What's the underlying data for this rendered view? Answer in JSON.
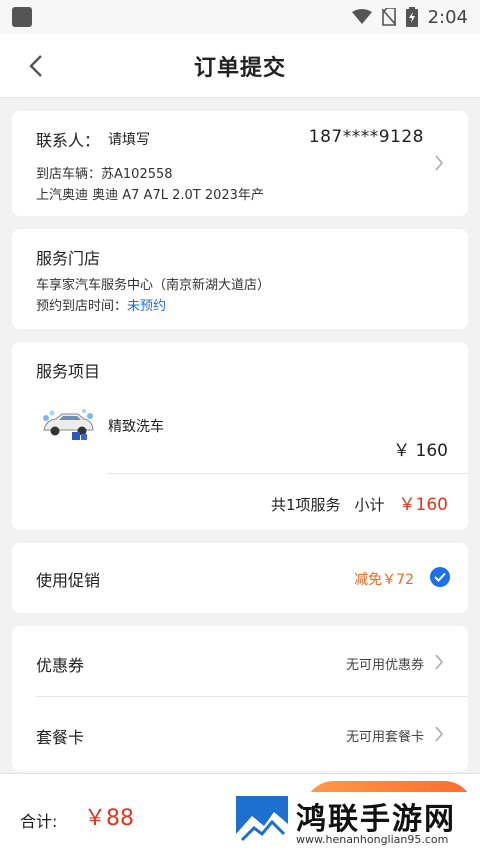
{
  "status_bar": {
    "time": "2:04"
  },
  "header": {
    "title": "订单提交"
  },
  "contact": {
    "label": "联系人：",
    "value": "请填写",
    "phone": "187****9128",
    "vehicle_label": "到店车辆：",
    "plate": "苏A102558",
    "model": "上汽奥迪 奥迪 A7 A7L 2.0T 2023年产"
  },
  "store": {
    "title": "服务门店",
    "name": "车享家汽车服务中心（南京新湖大道店）",
    "appointment_label": "预约到店时间：",
    "appointment_value": "未预约"
  },
  "service": {
    "title": "服务项目",
    "item_name": "精致洗车",
    "item_price": "￥ 160",
    "count_text": "共1项服务",
    "subtotal_label": "小计",
    "subtotal_value": "￥160"
  },
  "promo": {
    "label": "使用促销",
    "discount": "减免￥72",
    "checked": true
  },
  "coupon": {
    "label": "优惠券",
    "value": "无可用优惠券"
  },
  "package_card": {
    "label": "套餐卡",
    "value": "无可用套餐卡"
  },
  "bottom": {
    "total_label": "合计:",
    "total_value": "￥88"
  },
  "watermark": {
    "title": "鸿联手游网",
    "url": "www.henanhonglian95.com"
  },
  "colors": {
    "accent_red": "#e8341c",
    "promo_orange": "#ef6b1f",
    "link_blue": "#1f6fd6",
    "check_blue": "#1e6ff0"
  }
}
